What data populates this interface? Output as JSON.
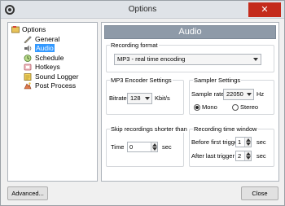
{
  "window": {
    "title": "Options",
    "close_glyph": "✕"
  },
  "tree": {
    "items": [
      {
        "label": "Options",
        "icon": "options-icon"
      },
      {
        "label": "General",
        "icon": "general-icon"
      },
      {
        "label": "Audio",
        "icon": "audio-icon",
        "selected": true
      },
      {
        "label": "Schedule",
        "icon": "schedule-icon"
      },
      {
        "label": "Hotkeys",
        "icon": "hotkeys-icon"
      },
      {
        "label": "Sound Logger",
        "icon": "sound-logger-icon"
      },
      {
        "label": "Post Process",
        "icon": "post-process-icon"
      }
    ]
  },
  "panel": {
    "heading": "Audio",
    "recording_format": {
      "legend": "Recording format",
      "value": "MP3 - real time encoding"
    },
    "mp3_encoder": {
      "legend": "MP3 Encoder Settings",
      "bitrate_label": "Bitrate",
      "bitrate_value": "128",
      "bitrate_unit": "Kbit/s"
    },
    "sampler": {
      "legend": "Sampler Settings",
      "rate_label": "Sample rate",
      "rate_value": "22050",
      "rate_unit": "Hz",
      "mono_label": "Mono",
      "stereo_label": "Stereo",
      "selected_channel": "Mono"
    },
    "skip": {
      "legend": "Skip recordings shorter than",
      "time_label": "Time",
      "time_value": "0",
      "time_unit": "sec"
    },
    "window": {
      "legend": "Recording time window",
      "before_label": "Before first trigger",
      "before_value": "1",
      "before_unit": "sec",
      "after_label": "After last trigger",
      "after_value": "2",
      "after_unit": "sec"
    }
  },
  "buttons": {
    "advanced": "Advanced...",
    "close": "Close"
  },
  "colors": {
    "selection": "#3399ff",
    "banner": "#8e9aa8",
    "close_button": "#c42b1c"
  }
}
